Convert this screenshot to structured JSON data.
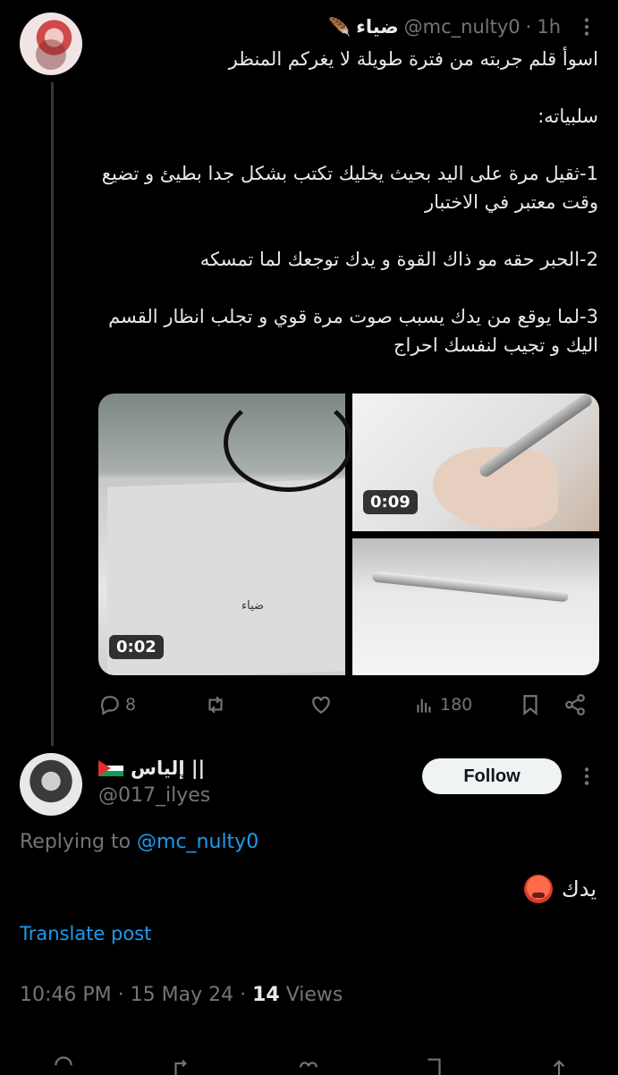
{
  "tweet": {
    "display_name": "ضياء",
    "handle": "@mc_nulty0",
    "time": "1h",
    "separator": "·",
    "text": "اسوأ قلم جربته من فترة طويلة لا يغركم المنظر\n\nسلبياته:\n\n1-ثقيل مرة على اليد بحيث يخليك تكتب بشكل جدا بطيئ و تضيع وقت معتبر في الاختبار\n\n2-الحبر حقه مو ذاك القوة و يدك توجعك لما تمسكه\n\n3-لما يوقع من يدك يسبب صوت مرة قوي و تجلب انظار القسم اليك و تجيب لنفسك احراج",
    "media": {
      "left_duration": "0:02",
      "top_right_duration": "0:09",
      "paper_scribble": "ضياء"
    },
    "actions": {
      "replies": "8",
      "views": "180"
    }
  },
  "reply": {
    "display_name": "إلياس ||",
    "handle": "@017_ilyes",
    "follow_label": "Follow",
    "replying_prefix": "Replying to",
    "replying_handle": "@mc_nulty0",
    "text": "يدك",
    "translate_label": "Translate post",
    "timestamp": "10:46 PM · 15 May 24 ·",
    "views_count": "14",
    "views_label": "Views"
  },
  "colors": {
    "background": "#000000",
    "text": "#e7e9ea",
    "muted": "#71767b",
    "link": "#1d9bf0"
  },
  "icons": [
    "feather-emoji-icon",
    "more-icon",
    "reply-icon",
    "retweet-icon",
    "like-icon",
    "views-icon",
    "bookmark-icon",
    "share-icon",
    "palestine-flag-icon",
    "hot-face-emoji-icon"
  ]
}
